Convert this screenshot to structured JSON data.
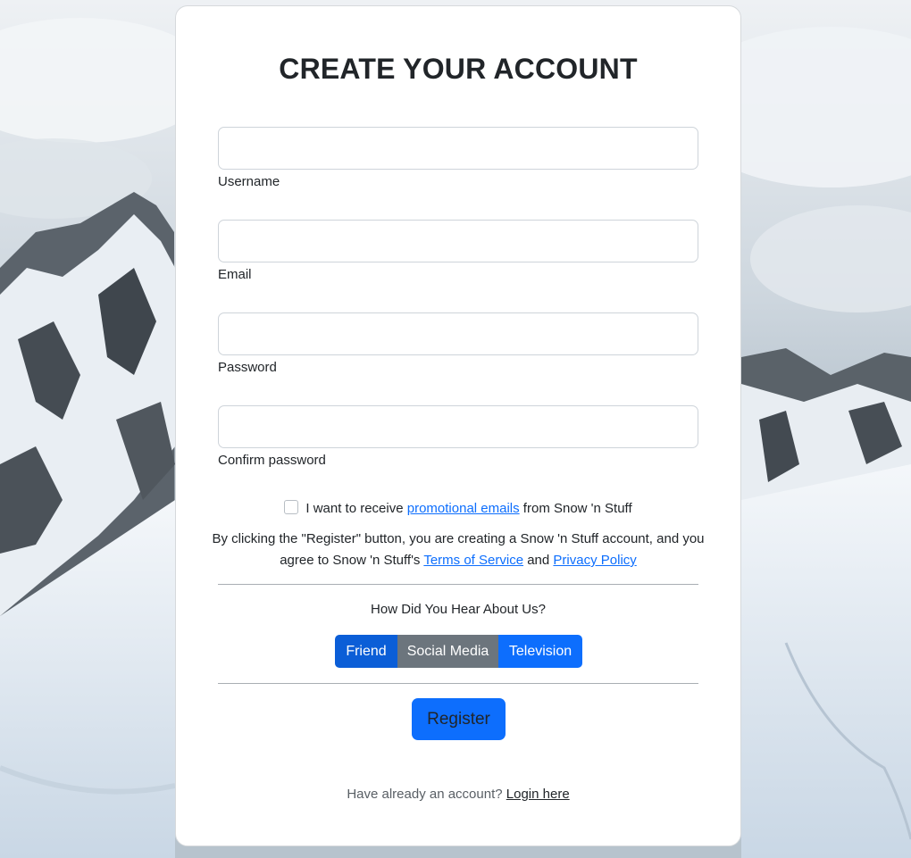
{
  "page": {
    "title": "CREATE YOUR ACCOUNT"
  },
  "form": {
    "fields": [
      {
        "label": "Username",
        "value": "",
        "placeholder": ""
      },
      {
        "label": "Email",
        "value": "",
        "placeholder": ""
      },
      {
        "label": "Password",
        "value": "",
        "placeholder": ""
      },
      {
        "label": "Confirm password",
        "value": "",
        "placeholder": ""
      }
    ],
    "promo": {
      "checked": false,
      "prefix": "I want to receive ",
      "link": "promotional emails",
      "suffix": " from Snow 'n Stuff"
    },
    "terms": {
      "text": "By clicking the \"Register\" button, you are creating a Snow 'n Stuff account, and you agree to Snow 'n Stuff's ",
      "tos_link": "Terms of Service",
      "and": " and ",
      "privacy_link": "Privacy Policy"
    },
    "hear": {
      "question": "How Did You Hear About Us?",
      "options": [
        "Friend",
        "Social Media",
        "Television"
      ],
      "selected": "Friend"
    },
    "register_label": "Register",
    "login": {
      "prompt": "Have already an account? ",
      "link": "Login here"
    }
  },
  "colors": {
    "primary": "#0d6efd",
    "primary_active": "#0b5ed7",
    "secondary": "#6c757d",
    "text": "#212529"
  }
}
